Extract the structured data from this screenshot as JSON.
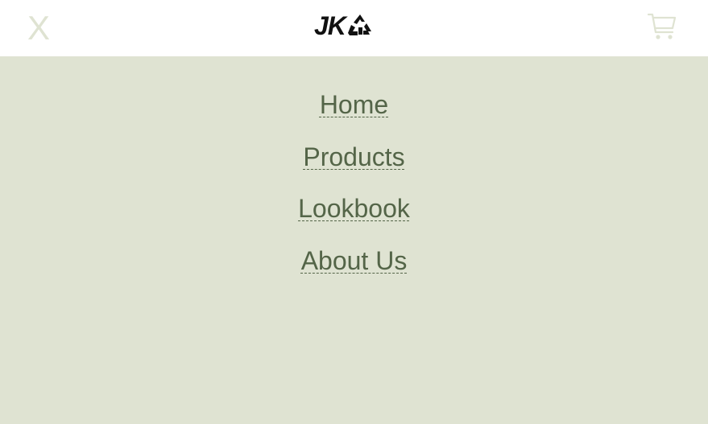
{
  "header": {
    "close_label": "X",
    "logo_text": "JK",
    "logo_icon": "recycle-icon",
    "cart_icon": "cart-icon"
  },
  "menu": {
    "items": [
      {
        "label": "Home"
      },
      {
        "label": "Products"
      },
      {
        "label": "Lookbook"
      },
      {
        "label": "About Us"
      }
    ]
  },
  "colors": {
    "background": "#dfe3d2",
    "header_bg": "#ffffff",
    "link": "#546548",
    "close_icon": "#dfe3d2",
    "logo": "#111111"
  }
}
